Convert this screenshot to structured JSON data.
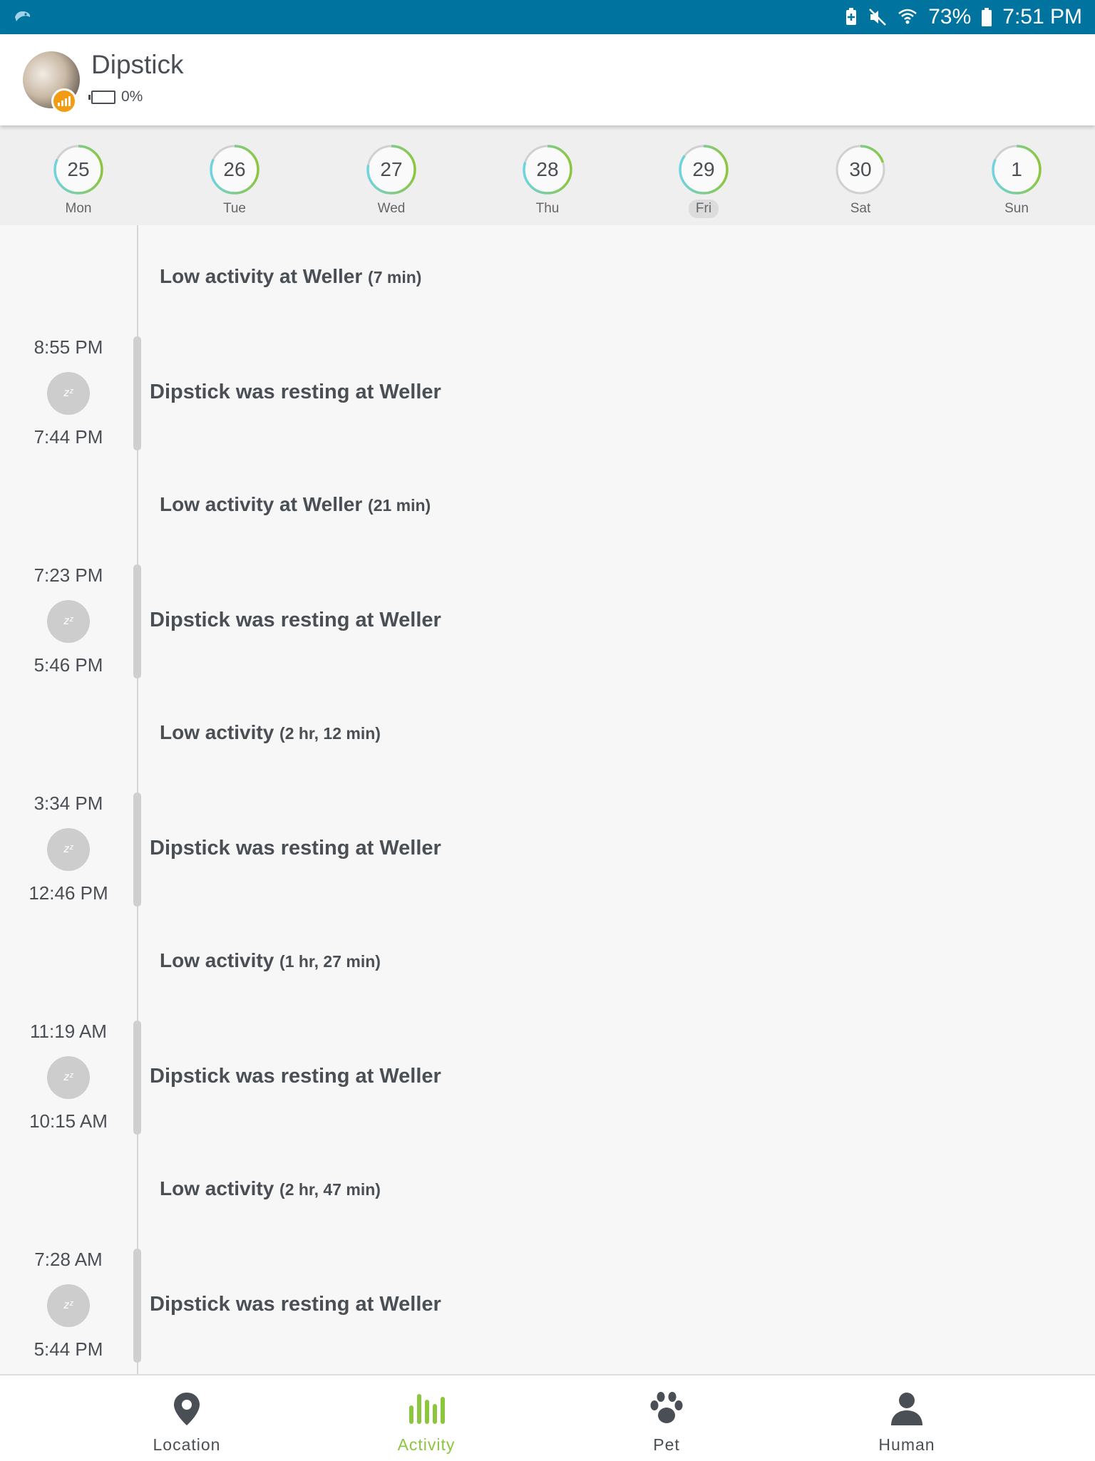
{
  "status_bar": {
    "battery_pct": "73%",
    "time": "7:51 PM"
  },
  "header": {
    "pet_name": "Dipstick",
    "battery_label": "0%"
  },
  "days": [
    {
      "num": "25",
      "name": "Mon",
      "progress": 0.82,
      "selected": false
    },
    {
      "num": "26",
      "name": "Tue",
      "progress": 0.82,
      "selected": false
    },
    {
      "num": "27",
      "name": "Wed",
      "progress": 0.78,
      "selected": false
    },
    {
      "num": "28",
      "name": "Thu",
      "progress": 0.8,
      "selected": false
    },
    {
      "num": "29",
      "name": "Fri",
      "progress": 0.85,
      "selected": true
    },
    {
      "num": "30",
      "name": "Sat",
      "progress": 0.2,
      "selected": false
    },
    {
      "num": "1",
      "name": "Sun",
      "progress": 0.82,
      "selected": false
    }
  ],
  "timeline": {
    "low_activities": [
      {
        "label": "Low activity at Weller",
        "duration": "(7 min)"
      },
      {
        "label": "Low activity at Weller",
        "duration": "(21 min)"
      },
      {
        "label": "Low activity",
        "duration": "(2 hr, 12 min)"
      },
      {
        "label": "Low activity",
        "duration": "(1 hr, 27 min)"
      },
      {
        "label": "Low activity",
        "duration": "(2 hr, 47 min)"
      }
    ],
    "rests": [
      {
        "end": "8:55 PM",
        "start": "7:44 PM",
        "text": "Dipstick was resting at Weller"
      },
      {
        "end": "7:23 PM",
        "start": "5:46 PM",
        "text": "Dipstick was resting at Weller"
      },
      {
        "end": "3:34 PM",
        "start": "12:46 PM",
        "text": "Dipstick was resting at Weller"
      },
      {
        "end": "11:19 AM",
        "start": "10:15 AM",
        "text": "Dipstick was resting at Weller"
      },
      {
        "end": "7:28 AM",
        "start": "5:44 PM",
        "text": "Dipstick was resting at Weller"
      }
    ]
  },
  "tabs": [
    {
      "label": "Location",
      "icon": "location-pin-icon",
      "active": false
    },
    {
      "label": "Activity",
      "icon": "activity-bars-icon",
      "active": true
    },
    {
      "label": "Pet",
      "icon": "paw-icon",
      "active": false
    },
    {
      "label": "Human",
      "icon": "person-icon",
      "active": false
    }
  ],
  "colors": {
    "status_bar": "#00739e",
    "accent": "#8cc63f",
    "badge": "#f39c12"
  }
}
